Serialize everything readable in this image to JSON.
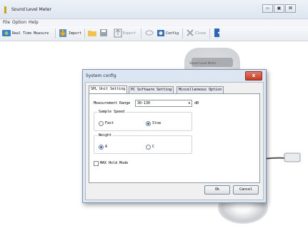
{
  "window": {
    "title": "Sound Level Meter",
    "min": "▭",
    "max": "▣",
    "close": "⊠"
  },
  "menu": [
    "File",
    "Option",
    "Help"
  ],
  "toolbar": {
    "real_time": "Real Time Measure",
    "import": "Import",
    "export": "Export",
    "config": "Config",
    "close": "Close"
  },
  "device": {
    "logo": "Sound Level Meter"
  },
  "dialog": {
    "title": "System config",
    "close": "x",
    "tabs": [
      "SPL Unit Setting",
      "PC Software Setting",
      "Miscellaneous Option"
    ],
    "measurement_range_label": "Measurement Range",
    "measurement_range_value": "30-130",
    "measurement_unit": "dB",
    "sample_speed": {
      "title": "Sample Speed",
      "fast": "Fast",
      "slow": "Slow",
      "selected": "Slow"
    },
    "weight": {
      "title": "Weight",
      "a": "A",
      "c": "C",
      "selected": "A"
    },
    "max_hold": "MAX Hold Mode",
    "ok": "Ok",
    "cancel": "Cancel"
  }
}
